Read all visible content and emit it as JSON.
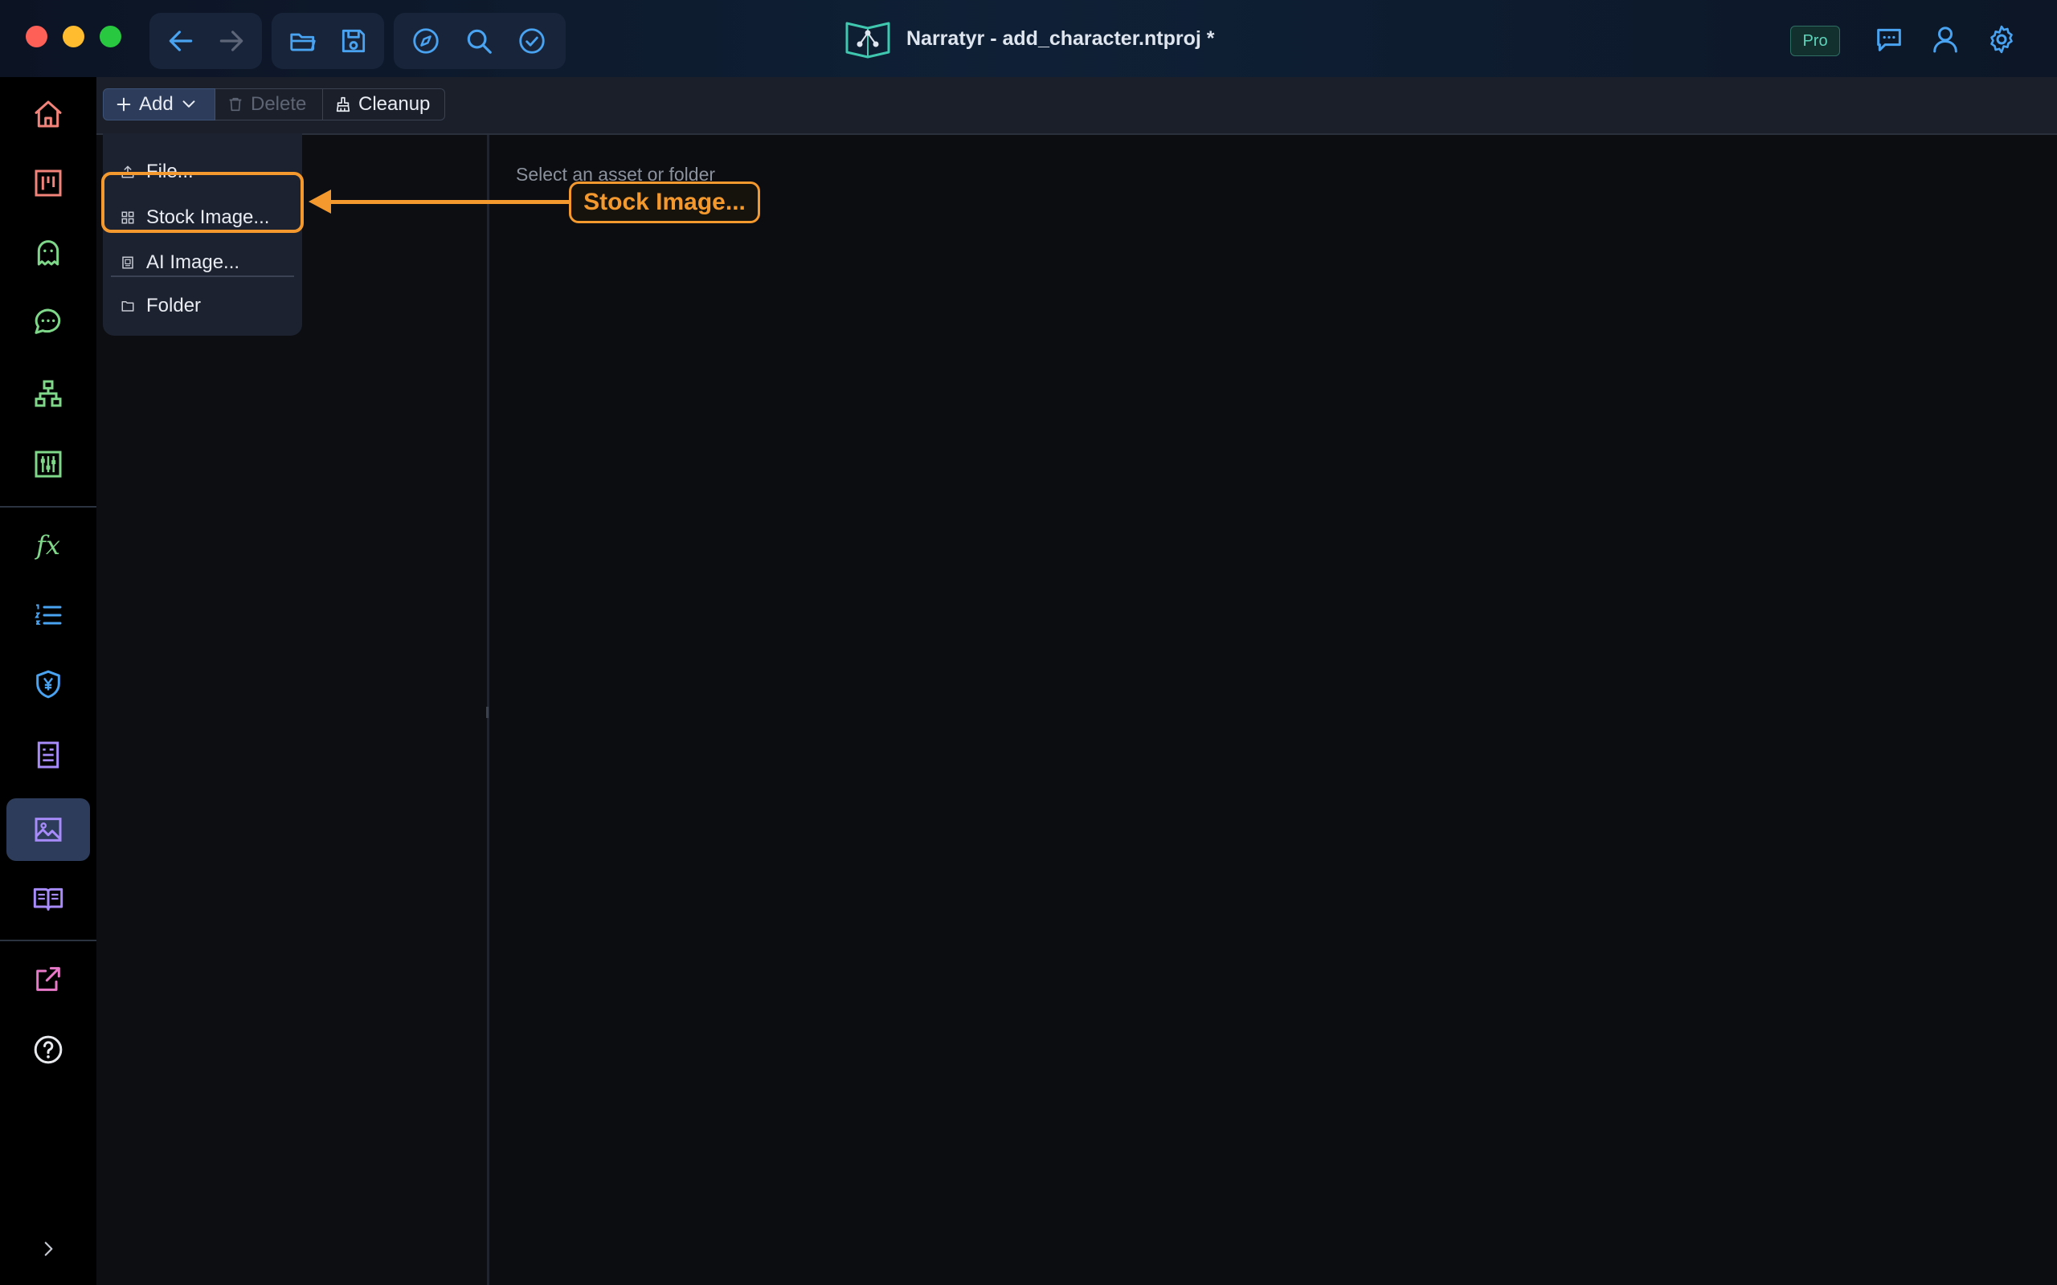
{
  "window": {
    "title": "Narratyr - add_character.ntproj *",
    "badge": "Pro"
  },
  "toolbar": {
    "add_label": "Add",
    "delete_label": "Delete",
    "cleanup_label": "Cleanup"
  },
  "add_menu": {
    "items": [
      {
        "label": "File...",
        "icon": "upload-icon"
      },
      {
        "label": "Stock Image...",
        "icon": "grid-icon"
      },
      {
        "label": "AI Image...",
        "icon": "ai-image-icon"
      },
      {
        "label": "Folder",
        "icon": "folder-icon"
      }
    ]
  },
  "content": {
    "placeholder": "Select an asset or folder"
  },
  "annotation": {
    "label": "Stock Image..."
  },
  "sidebar": {
    "active": "assets",
    "items": [
      "home-icon",
      "board-icon",
      "ghost-icon",
      "chat-icon",
      "hierarchy-icon",
      "sliders-icon",
      "fx-icon",
      "numbered-list-icon",
      "shield-yen-icon",
      "document-icon",
      "image-icon",
      "book-icon",
      "export-icon",
      "help-icon",
      "expand-icon"
    ]
  },
  "colors": {
    "accent_orange": "#f4992d",
    "active_blue": "#2c3c5a",
    "pro_green": "#5fd3b9"
  }
}
